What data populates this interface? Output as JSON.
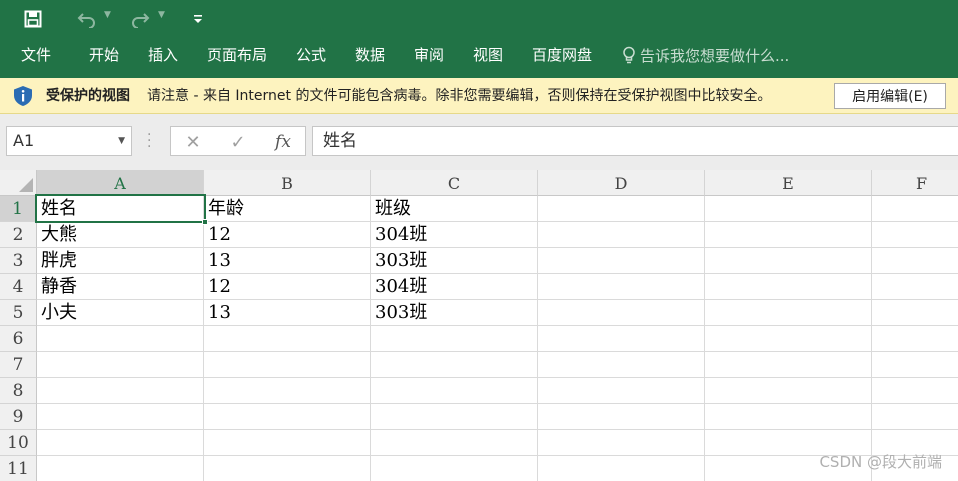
{
  "qat": {
    "save_icon": "save-icon",
    "undo_icon": "undo-icon",
    "redo_icon": "redo-icon",
    "customize_icon": "customize-qat-icon"
  },
  "ribbon": {
    "tabs": [
      "文件",
      "开始",
      "插入",
      "页面布局",
      "公式",
      "数据",
      "审阅",
      "视图",
      "百度网盘"
    ],
    "tell_me": "告诉我您想要做什么..."
  },
  "protected_view": {
    "title": "受保护的视图",
    "message": "请注意 - 来自 Internet 的文件可能包含病毒。除非您需要编辑，否则保持在受保护视图中比较安全。",
    "button": "启用编辑(E)"
  },
  "formula_bar": {
    "name_box": "A1",
    "cancel": "✕",
    "enter": "✓",
    "fx": "fx",
    "value": "姓名"
  },
  "sheet": {
    "columns": [
      "A",
      "B",
      "C",
      "D",
      "E",
      "F"
    ],
    "row_numbers": [
      "1",
      "2",
      "3",
      "4",
      "5",
      "6",
      "7",
      "8",
      "9",
      "10",
      "11"
    ],
    "rows": [
      [
        "姓名",
        "年龄",
        "班级",
        "",
        "",
        ""
      ],
      [
        "大熊",
        "12",
        "304班",
        "",
        "",
        ""
      ],
      [
        "胖虎",
        "13",
        "303班",
        "",
        "",
        ""
      ],
      [
        "静香",
        "12",
        "304班",
        "",
        "",
        ""
      ],
      [
        "小夫",
        "13",
        "303班",
        "",
        "",
        ""
      ],
      [
        "",
        "",
        "",
        "",
        "",
        ""
      ],
      [
        "",
        "",
        "",
        "",
        "",
        ""
      ],
      [
        "",
        "",
        "",
        "",
        "",
        ""
      ],
      [
        "",
        "",
        "",
        "",
        "",
        ""
      ],
      [
        "",
        "",
        "",
        "",
        "",
        ""
      ],
      [
        "",
        "",
        "",
        "",
        "",
        ""
      ]
    ],
    "active_cell": "A1"
  },
  "watermark": "CSDN @段大前端",
  "colors": {
    "excel_green": "#217346",
    "warning_bar": "#fdf3bf",
    "header_gray": "#f0f0f0"
  }
}
